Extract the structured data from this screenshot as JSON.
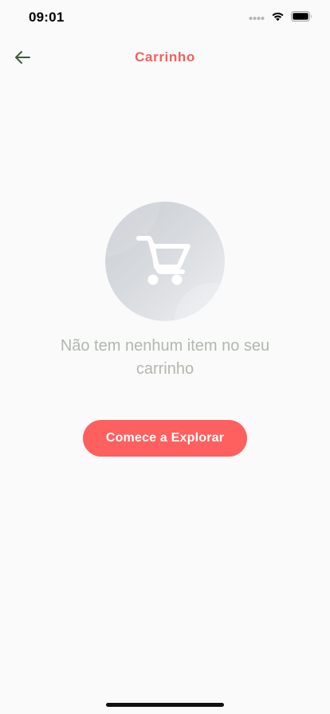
{
  "status_bar": {
    "time": "09:01",
    "icons": [
      "signal-dots-icon",
      "wifi-icon",
      "battery-icon"
    ]
  },
  "header": {
    "back_icon": "arrow-left-icon",
    "title": "Carrinho"
  },
  "empty_state": {
    "illustration_icon": "shopping-cart-icon",
    "message": "Não tem nenhum item no seu carrinho",
    "button_label": "Comece a Explorar"
  },
  "colors": {
    "accent": "#fe5f5f",
    "title": "#f25f5c",
    "message": "#b1b8ae",
    "back_arrow": "#3f5a3a",
    "background": "#fafafa"
  }
}
